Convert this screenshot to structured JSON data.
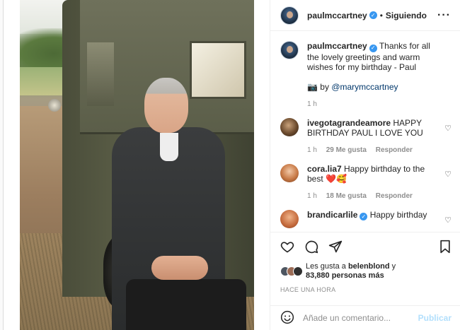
{
  "header": {
    "username": "paulmccartney",
    "separator": "•",
    "follow_status": "Siguiendo",
    "more_icon": "ellipsis-icon"
  },
  "caption": {
    "username": "paulmccartney",
    "text": "Thanks for all the lovely greetings and warm wishes for my birthday - Paul",
    "credit_emoji": "📷",
    "credit_by": "by",
    "credit_mention": "@marymccartney",
    "time": "1 h"
  },
  "comments": [
    {
      "username": "ivegotagrandeamore",
      "text": "HAPPY BIRTHDAY PAUL I LOVE YOU",
      "time": "1 h",
      "likes": "29 Me gusta",
      "reply": "Responder"
    },
    {
      "username": "cora.lia7",
      "text": "Happy birthday to the best ❤️🥰",
      "time": "1 h",
      "likes": "18 Me gusta",
      "reply": "Responder"
    },
    {
      "username": "brandicarlile",
      "text": "Happy birthday",
      "time": "",
      "likes": "",
      "reply": ""
    }
  ],
  "likes": {
    "prefix": "Les gusta a",
    "first_liker": "belenblond",
    "conjunction": "y",
    "others": "83,880 personas más"
  },
  "posted_ago": "HACE UNA HORA",
  "add_comment": {
    "placeholder": "Añade un comentario...",
    "publish_label": "Publicar"
  },
  "colors": {
    "verified": "#3897f0",
    "link": "#00376b",
    "publish_disabled": "#b2dffc",
    "muted": "#8e8e8e"
  }
}
